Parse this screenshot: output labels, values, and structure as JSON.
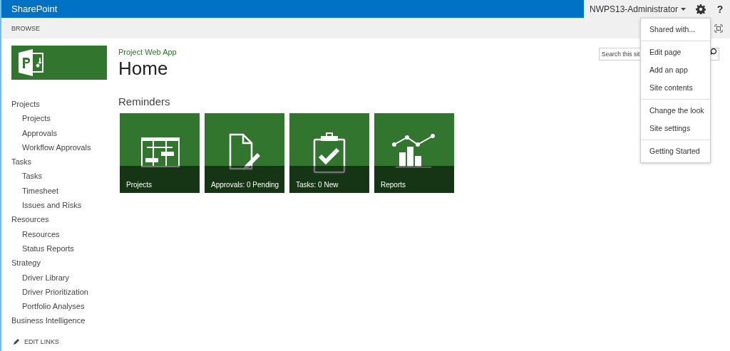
{
  "top_bar": {
    "brand": "SharePoint",
    "user": "NWPS13-Administrator",
    "help": "?"
  },
  "ribbon": {
    "tab": "BROWSE"
  },
  "site": {
    "subtitle": "Project Web App",
    "title": "Home"
  },
  "search": {
    "placeholder": "Search this sit"
  },
  "nav": [
    {
      "label": "Projects",
      "children": [
        {
          "label": "Projects"
        },
        {
          "label": "Approvals"
        },
        {
          "label": "Workflow Approvals"
        }
      ]
    },
    {
      "label": "Tasks",
      "children": [
        {
          "label": "Tasks"
        },
        {
          "label": "Timesheet"
        },
        {
          "label": "Issues and Risks"
        }
      ]
    },
    {
      "label": "Resources",
      "children": [
        {
          "label": "Resources"
        },
        {
          "label": "Status Reports"
        }
      ]
    },
    {
      "label": "Strategy",
      "children": [
        {
          "label": "Driver Library"
        },
        {
          "label": "Driver Prioritization"
        },
        {
          "label": "Portfolio Analyses"
        }
      ]
    },
    {
      "label": "Business Intelligence"
    }
  ],
  "edit_links": "EDIT LINKS",
  "reminders": {
    "heading": "Reminders",
    "tiles": [
      {
        "kind": "projects",
        "label": "Projects"
      },
      {
        "kind": "approvals",
        "label": "Approvals: 0 Pending"
      },
      {
        "kind": "tasks",
        "label": "Tasks: 0 New"
      },
      {
        "kind": "reports",
        "label": "Reports"
      }
    ]
  },
  "settings_menu": [
    [
      "Shared with..."
    ],
    [
      "Edit page",
      "Add an app",
      "Site contents"
    ],
    [
      "Change the look",
      "Site settings"
    ],
    [
      "Getting Started"
    ]
  ]
}
